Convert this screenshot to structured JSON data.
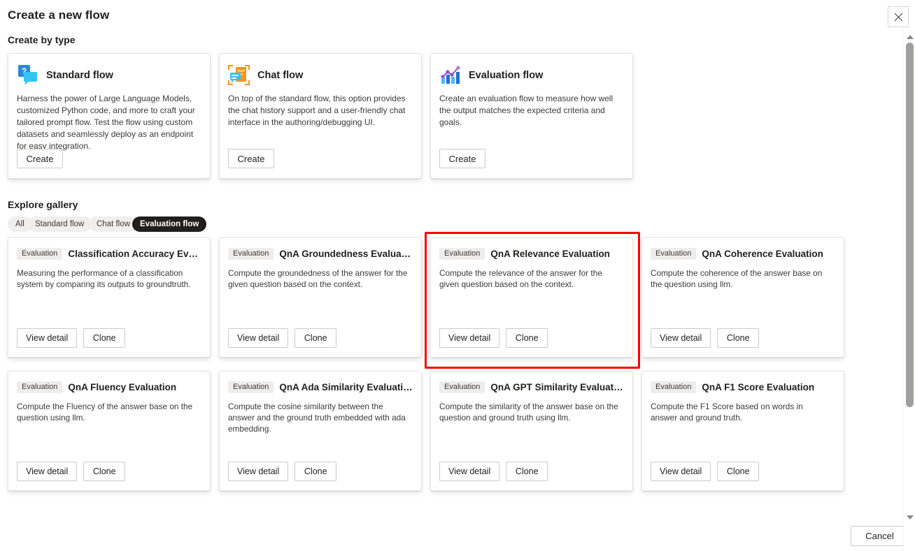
{
  "dialog": {
    "title": "Create a new flow",
    "close_icon": "close-icon"
  },
  "create_by_type": {
    "heading": "Create by type",
    "cards": [
      {
        "icon": "standard-flow-icon",
        "name": "Standard flow",
        "description": "Harness the power of Large Language Models, customized Python code, and more to craft your tailored prompt flow. Test the flow using custom datasets and seamlessly deploy as an endpoint for easy integration.",
        "button": "Create"
      },
      {
        "icon": "chat-flow-icon",
        "name": "Chat flow",
        "description": "On top of the standard flow, this option provides the chat history support and a user-friendly chat interface in the authoring/debugging UI.",
        "button": "Create"
      },
      {
        "icon": "evaluation-flow-icon",
        "name": "Evaluation flow",
        "description": "Create an evaluation flow to measure how well the output matches the expected criteria and goals.",
        "button": "Create"
      }
    ]
  },
  "explore_gallery": {
    "heading": "Explore gallery",
    "filters": [
      {
        "label": "All",
        "selected": false
      },
      {
        "label": "Standard flow",
        "selected": false
      },
      {
        "label": "Chat flow",
        "selected": false
      },
      {
        "label": "Evaluation flow",
        "selected": true
      }
    ],
    "cards": [
      {
        "badge": "Evaluation",
        "title": "Classification Accuracy Evalu...",
        "description": "Measuring the performance of a classification system by comparing its outputs to groundtruth.",
        "view_detail": "View detail",
        "clone": "Clone",
        "highlighted": false
      },
      {
        "badge": "Evaluation",
        "title": "QnA Groundedness Evaluation",
        "description": "Compute the groundedness of the answer for the given question based on the context.",
        "view_detail": "View detail",
        "clone": "Clone",
        "highlighted": false
      },
      {
        "badge": "Evaluation",
        "title": "QnA Relevance Evaluation",
        "description": "Compute the relevance of the answer for the given question based on the context.",
        "view_detail": "View detail",
        "clone": "Clone",
        "highlighted": true
      },
      {
        "badge": "Evaluation",
        "title": "QnA Coherence Evaluation",
        "description": "Compute the coherence of the answer base on the question using llm.",
        "view_detail": "View detail",
        "clone": "Clone",
        "highlighted": false
      },
      {
        "badge": "Evaluation",
        "title": "QnA Fluency Evaluation",
        "description": "Compute the Fluency of the answer base on the question using llm.",
        "view_detail": "View detail",
        "clone": "Clone",
        "highlighted": false
      },
      {
        "badge": "Evaluation",
        "title": "QnA Ada Similarity Evaluation",
        "description": "Compute the cosine similarity between the answer and the ground truth embedded with ada embedding.",
        "view_detail": "View detail",
        "clone": "Clone",
        "highlighted": false
      },
      {
        "badge": "Evaluation",
        "title": "QnA GPT Similarity Evaluation",
        "description": "Compute the similarity of the answer base on the question and ground truth using llm.",
        "view_detail": "View detail",
        "clone": "Clone",
        "highlighted": false
      },
      {
        "badge": "Evaluation",
        "title": "QnA F1 Score Evaluation",
        "description": "Compute the F1 Score based on words in answer and ground truth.",
        "view_detail": "View detail",
        "clone": "Clone",
        "highlighted": false
      }
    ]
  },
  "footer": {
    "cancel": "Cancel"
  },
  "scrollbar": {
    "up_icon": "scroll-up-arrow-icon",
    "down_icon": "scroll-down-arrow-icon"
  },
  "colors": {
    "highlight": "#ff0000",
    "pill_selected_bg": "#201f1e",
    "standard_icon": "#2b88d8",
    "chat_icon": "#f7941d",
    "eval_icon": "#8a4fd0"
  }
}
